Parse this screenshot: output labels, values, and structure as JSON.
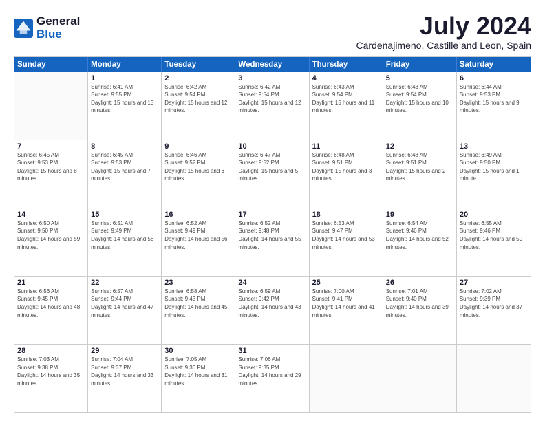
{
  "logo": {
    "general": "General",
    "blue": "Blue"
  },
  "title": "July 2024",
  "subtitle": "Cardenajimeno, Castille and Leon, Spain",
  "headers": [
    "Sunday",
    "Monday",
    "Tuesday",
    "Wednesday",
    "Thursday",
    "Friday",
    "Saturday"
  ],
  "weeks": [
    [
      {
        "day": "",
        "sunrise": "",
        "sunset": "",
        "daylight": ""
      },
      {
        "day": "1",
        "sunrise": "Sunrise: 6:41 AM",
        "sunset": "Sunset: 9:55 PM",
        "daylight": "Daylight: 15 hours and 13 minutes."
      },
      {
        "day": "2",
        "sunrise": "Sunrise: 6:42 AM",
        "sunset": "Sunset: 9:54 PM",
        "daylight": "Daylight: 15 hours and 12 minutes."
      },
      {
        "day": "3",
        "sunrise": "Sunrise: 6:42 AM",
        "sunset": "Sunset: 9:54 PM",
        "daylight": "Daylight: 15 hours and 12 minutes."
      },
      {
        "day": "4",
        "sunrise": "Sunrise: 6:43 AM",
        "sunset": "Sunset: 9:54 PM",
        "daylight": "Daylight: 15 hours and 11 minutes."
      },
      {
        "day": "5",
        "sunrise": "Sunrise: 6:43 AM",
        "sunset": "Sunset: 9:54 PM",
        "daylight": "Daylight: 15 hours and 10 minutes."
      },
      {
        "day": "6",
        "sunrise": "Sunrise: 6:44 AM",
        "sunset": "Sunset: 9:53 PM",
        "daylight": "Daylight: 15 hours and 9 minutes."
      }
    ],
    [
      {
        "day": "7",
        "sunrise": "Sunrise: 6:45 AM",
        "sunset": "Sunset: 9:53 PM",
        "daylight": "Daylight: 15 hours and 8 minutes."
      },
      {
        "day": "8",
        "sunrise": "Sunrise: 6:45 AM",
        "sunset": "Sunset: 9:53 PM",
        "daylight": "Daylight: 15 hours and 7 minutes."
      },
      {
        "day": "9",
        "sunrise": "Sunrise: 6:46 AM",
        "sunset": "Sunset: 9:52 PM",
        "daylight": "Daylight: 15 hours and 6 minutes."
      },
      {
        "day": "10",
        "sunrise": "Sunrise: 6:47 AM",
        "sunset": "Sunset: 9:52 PM",
        "daylight": "Daylight: 15 hours and 5 minutes."
      },
      {
        "day": "11",
        "sunrise": "Sunrise: 6:48 AM",
        "sunset": "Sunset: 9:51 PM",
        "daylight": "Daylight: 15 hours and 3 minutes."
      },
      {
        "day": "12",
        "sunrise": "Sunrise: 6:48 AM",
        "sunset": "Sunset: 9:51 PM",
        "daylight": "Daylight: 15 hours and 2 minutes."
      },
      {
        "day": "13",
        "sunrise": "Sunrise: 6:49 AM",
        "sunset": "Sunset: 9:50 PM",
        "daylight": "Daylight: 15 hours and 1 minute."
      }
    ],
    [
      {
        "day": "14",
        "sunrise": "Sunrise: 6:50 AM",
        "sunset": "Sunset: 9:50 PM",
        "daylight": "Daylight: 14 hours and 59 minutes."
      },
      {
        "day": "15",
        "sunrise": "Sunrise: 6:51 AM",
        "sunset": "Sunset: 9:49 PM",
        "daylight": "Daylight: 14 hours and 58 minutes."
      },
      {
        "day": "16",
        "sunrise": "Sunrise: 6:52 AM",
        "sunset": "Sunset: 9:49 PM",
        "daylight": "Daylight: 14 hours and 56 minutes."
      },
      {
        "day": "17",
        "sunrise": "Sunrise: 6:52 AM",
        "sunset": "Sunset: 9:48 PM",
        "daylight": "Daylight: 14 hours and 55 minutes."
      },
      {
        "day": "18",
        "sunrise": "Sunrise: 6:53 AM",
        "sunset": "Sunset: 9:47 PM",
        "daylight": "Daylight: 14 hours and 53 minutes."
      },
      {
        "day": "19",
        "sunrise": "Sunrise: 6:54 AM",
        "sunset": "Sunset: 9:46 PM",
        "daylight": "Daylight: 14 hours and 52 minutes."
      },
      {
        "day": "20",
        "sunrise": "Sunrise: 6:55 AM",
        "sunset": "Sunset: 9:46 PM",
        "daylight": "Daylight: 14 hours and 50 minutes."
      }
    ],
    [
      {
        "day": "21",
        "sunrise": "Sunrise: 6:56 AM",
        "sunset": "Sunset: 9:45 PM",
        "daylight": "Daylight: 14 hours and 48 minutes."
      },
      {
        "day": "22",
        "sunrise": "Sunrise: 6:57 AM",
        "sunset": "Sunset: 9:44 PM",
        "daylight": "Daylight: 14 hours and 47 minutes."
      },
      {
        "day": "23",
        "sunrise": "Sunrise: 6:58 AM",
        "sunset": "Sunset: 9:43 PM",
        "daylight": "Daylight: 14 hours and 45 minutes."
      },
      {
        "day": "24",
        "sunrise": "Sunrise: 6:59 AM",
        "sunset": "Sunset: 9:42 PM",
        "daylight": "Daylight: 14 hours and 43 minutes."
      },
      {
        "day": "25",
        "sunrise": "Sunrise: 7:00 AM",
        "sunset": "Sunset: 9:41 PM",
        "daylight": "Daylight: 14 hours and 41 minutes."
      },
      {
        "day": "26",
        "sunrise": "Sunrise: 7:01 AM",
        "sunset": "Sunset: 9:40 PM",
        "daylight": "Daylight: 14 hours and 39 minutes."
      },
      {
        "day": "27",
        "sunrise": "Sunrise: 7:02 AM",
        "sunset": "Sunset: 9:39 PM",
        "daylight": "Daylight: 14 hours and 37 minutes."
      }
    ],
    [
      {
        "day": "28",
        "sunrise": "Sunrise: 7:03 AM",
        "sunset": "Sunset: 9:38 PM",
        "daylight": "Daylight: 14 hours and 35 minutes."
      },
      {
        "day": "29",
        "sunrise": "Sunrise: 7:04 AM",
        "sunset": "Sunset: 9:37 PM",
        "daylight": "Daylight: 14 hours and 33 minutes."
      },
      {
        "day": "30",
        "sunrise": "Sunrise: 7:05 AM",
        "sunset": "Sunset: 9:36 PM",
        "daylight": "Daylight: 14 hours and 31 minutes."
      },
      {
        "day": "31",
        "sunrise": "Sunrise: 7:06 AM",
        "sunset": "Sunset: 9:35 PM",
        "daylight": "Daylight: 14 hours and 29 minutes."
      },
      {
        "day": "",
        "sunrise": "",
        "sunset": "",
        "daylight": ""
      },
      {
        "day": "",
        "sunrise": "",
        "sunset": "",
        "daylight": ""
      },
      {
        "day": "",
        "sunrise": "",
        "sunset": "",
        "daylight": ""
      }
    ]
  ]
}
